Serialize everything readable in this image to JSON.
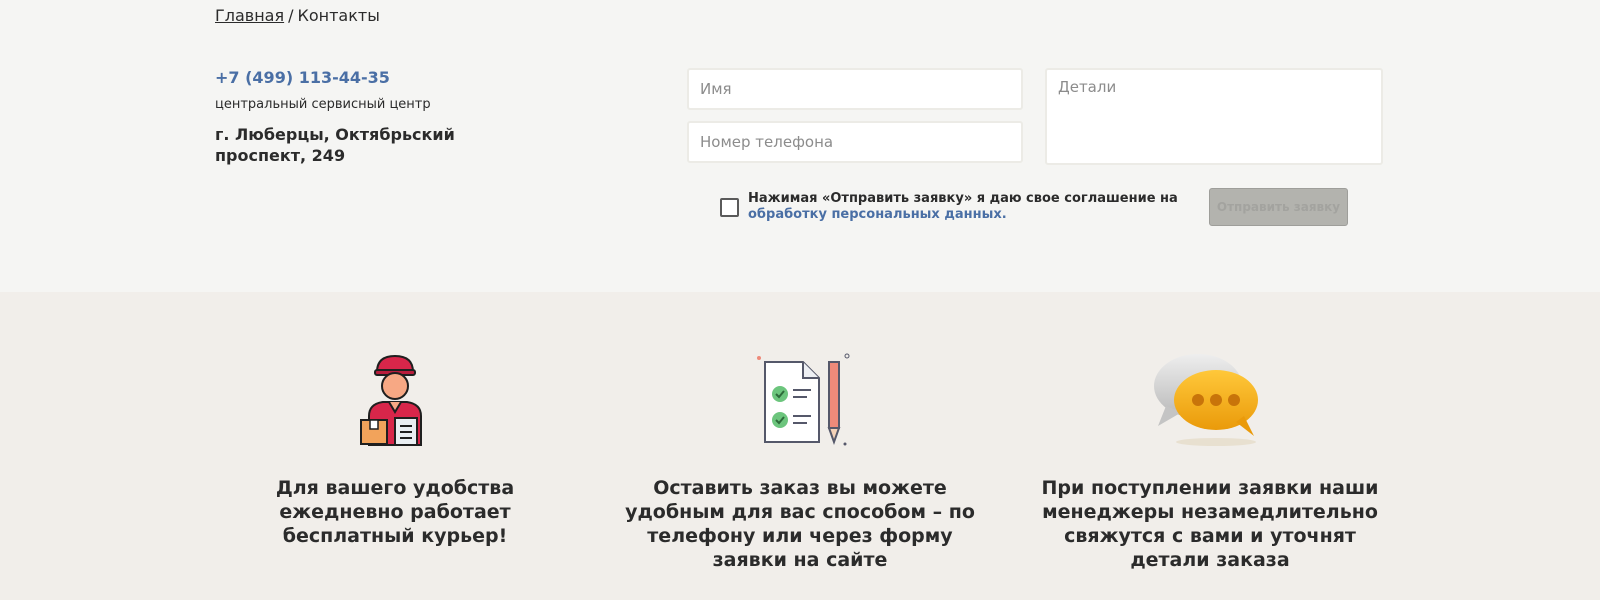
{
  "breadcrumb": {
    "home": "Главная",
    "separator": "/",
    "current": "Контакты"
  },
  "contact": {
    "phone": "+7 (499) 113-44-35",
    "service_center": "центральный сервисный центр",
    "address": "г. Люберцы, Октябрьский проспект, 249"
  },
  "form": {
    "name_placeholder": "Имя",
    "phone_placeholder": "Номер телефона",
    "details_placeholder": "Детали",
    "consent_text": "Нажимая «Отправить заявку» я даю свое соглашение на",
    "consent_link": "обработку персональных данных.",
    "submit_label": "Отправить заявку"
  },
  "features": [
    {
      "icon": "courier-icon",
      "caption": "Для вашего удобства ежедневно работает бесплатный курьер!"
    },
    {
      "icon": "document-pencil-icon",
      "caption": "Оставить заказ вы можете удобным для вас способом – по телефону или через форму заявки на сайте"
    },
    {
      "icon": "chat-bubbles-icon",
      "caption": "При поступлении заявки наши менеджеры незамедлительно свяжутся с вами и уточнят детали заказа"
    }
  ],
  "colors": {
    "accent": "#4a6fa5",
    "button_disabled": "#b3b3ae",
    "courier_red": "#d8264a",
    "chat_orange": "#f2a10f"
  }
}
